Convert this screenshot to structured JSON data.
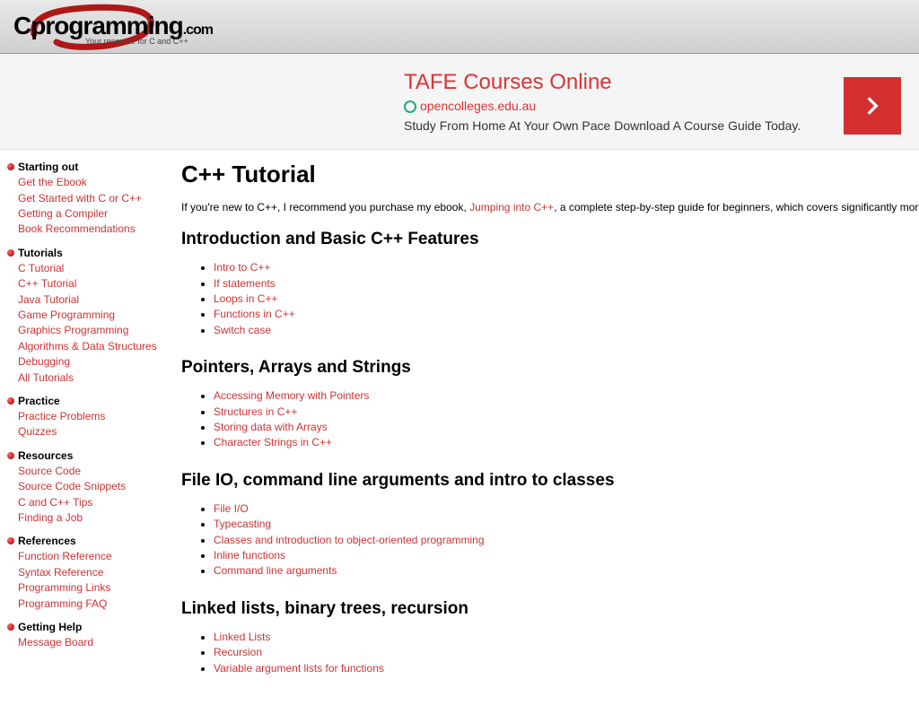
{
  "logo": {
    "main": "Cprogramming",
    "suffix": ".com",
    "tagline": "Your resource for C and C++"
  },
  "ad": {
    "title": "TAFE Courses Online",
    "url": "opencolleges.edu.au",
    "desc": "Study From Home At Your Own Pace Download A Course Guide Today."
  },
  "sidebar": [
    {
      "heading": "Starting out",
      "links": [
        "Get the Ebook",
        "Get Started with C or C++",
        "Getting a Compiler",
        "Book Recommendations"
      ]
    },
    {
      "heading": "Tutorials",
      "links": [
        "C Tutorial",
        "C++ Tutorial",
        "Java Tutorial",
        "Game Programming",
        "Graphics Programming",
        "Algorithms & Data Structures",
        "Debugging",
        "All Tutorials"
      ]
    },
    {
      "heading": "Practice",
      "links": [
        "Practice Problems",
        "Quizzes"
      ]
    },
    {
      "heading": "Resources",
      "links": [
        "Source Code",
        "Source Code Snippets",
        "C and C++ Tips",
        "Finding a Job"
      ]
    },
    {
      "heading": "References",
      "links": [
        "Function Reference",
        "Syntax Reference",
        "Programming Links",
        "Programming FAQ"
      ]
    },
    {
      "heading": "Getting Help",
      "links": [
        "Message Board"
      ]
    }
  ],
  "page": {
    "title": "C++ Tutorial",
    "intro_before": "If you're new to C++, I recommend you purchase my ebook, ",
    "intro_link": "Jumping into C++",
    "intro_after": ", a complete step-by-step guide for beginners, which covers significantly more"
  },
  "sections": [
    {
      "heading": "Introduction and Basic C++ Features",
      "items": [
        "Intro to C++",
        "If statements",
        "Loops in C++",
        "Functions in C++",
        "Switch case"
      ]
    },
    {
      "heading": "Pointers, Arrays and Strings",
      "items": [
        "Accessing Memory with Pointers",
        "Structures in C++",
        "Storing data with Arrays",
        "Character Strings in C++"
      ]
    },
    {
      "heading": "File IO, command line arguments and intro to classes",
      "items": [
        "File I/O",
        "Typecasting",
        "Classes and introduction to object-oriented programming",
        "Inline functions",
        "Command line arguments"
      ]
    },
    {
      "heading": "Linked lists, binary trees, recursion",
      "items": [
        "Linked Lists",
        "Recursion",
        "Variable argument lists for functions"
      ]
    }
  ]
}
